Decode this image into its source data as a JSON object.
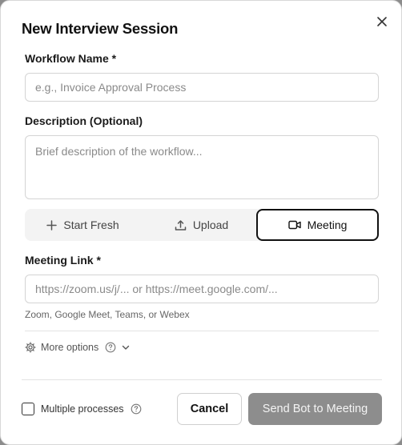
{
  "dialog": {
    "title": "New Interview Session"
  },
  "workflow_name": {
    "label": "Workflow Name *",
    "placeholder": "e.g., Invoice Approval Process",
    "value": ""
  },
  "description": {
    "label": "Description (Optional)",
    "placeholder": "Brief description of the workflow...",
    "value": ""
  },
  "modes": {
    "items": [
      {
        "label": "Start Fresh",
        "icon": "plus-icon",
        "active": false
      },
      {
        "label": "Upload",
        "icon": "upload-icon",
        "active": false
      },
      {
        "label": "Meeting",
        "icon": "video-camera-icon",
        "active": true
      }
    ]
  },
  "meeting_link": {
    "label": "Meeting Link *",
    "placeholder": "https://zoom.us/j/... or https://meet.google.com/...",
    "value": "",
    "hint": "Zoom, Google Meet, Teams, or Webex"
  },
  "more_options": {
    "label": "More options"
  },
  "footer": {
    "multiple_processes_label": "Multiple processes",
    "multiple_processes_checked": false,
    "cancel_label": "Cancel",
    "send_label": "Send Bot to Meeting"
  },
  "colors": {
    "active_border": "#111111",
    "disabled_button": "#8d8d8d"
  }
}
